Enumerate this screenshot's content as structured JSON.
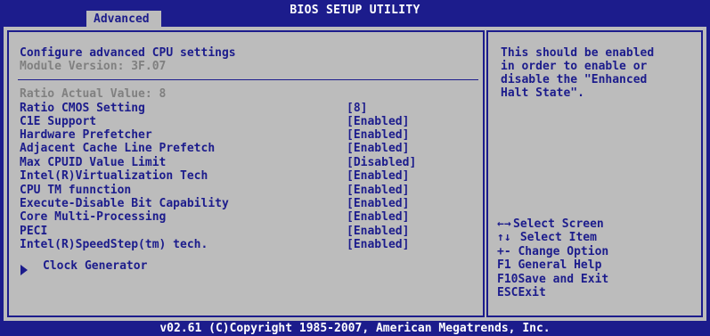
{
  "header": {
    "title": "BIOS SETUP UTILITY",
    "active_tab": "Advanced"
  },
  "settings": {
    "heading": "Configure advanced CPU settings",
    "module_version": "Module Version: 3F.07",
    "ratio_actual": "Ratio Actual Value: 8",
    "items": [
      {
        "label": "Ratio CMOS Setting",
        "value": "[8]"
      },
      {
        "label": "C1E Support",
        "value": "[Enabled]"
      },
      {
        "label": "Hardware Prefetcher",
        "value": "[Enabled]"
      },
      {
        "label": "Adjacent Cache Line Prefetch",
        "value": "[Enabled]"
      },
      {
        "label": "Max CPUID Value Limit",
        "value": "[Disabled]"
      },
      {
        "label": "Intel(R)Virtualization Tech",
        "value": "[Enabled]"
      },
      {
        "label": "CPU TM funnction",
        "value": "[Enabled]"
      },
      {
        "label": "Execute-Disable Bit Capability",
        "value": "[Enabled]"
      },
      {
        "label": "Core Multi-Processing",
        "value": "[Enabled]"
      },
      {
        "label": "PECI",
        "value": "[Enabled]"
      },
      {
        "label": "Intel(R)SpeedStep(tm) tech.",
        "value": "[Enabled]"
      }
    ],
    "submenu_clock": "Clock Generator"
  },
  "help": {
    "line1": "This should be enabled",
    "line2": "in order to enable or",
    "line3": "disable the \"Enhanced",
    "line4": "Halt State\"."
  },
  "keys": [
    {
      "icon": "←→",
      "text": "Select Screen"
    },
    {
      "icon": "↑↓",
      "text": " Select Item"
    },
    {
      "icon": "+-",
      "text": " Change Option"
    },
    {
      "icon": "F1",
      "text": " General Help"
    },
    {
      "icon": "F10",
      "text": "Save and Exit"
    },
    {
      "icon": "ESC",
      "text": "Exit"
    }
  ],
  "footer": {
    "copyright": "v02.61 (C)Copyright 1985-2007, American Megatrends, Inc."
  },
  "colors": {
    "bios_blue": "#1c1c8c",
    "panel_grey": "#bcbcbc",
    "text_grey": "#808080",
    "white": "#ffffff"
  }
}
